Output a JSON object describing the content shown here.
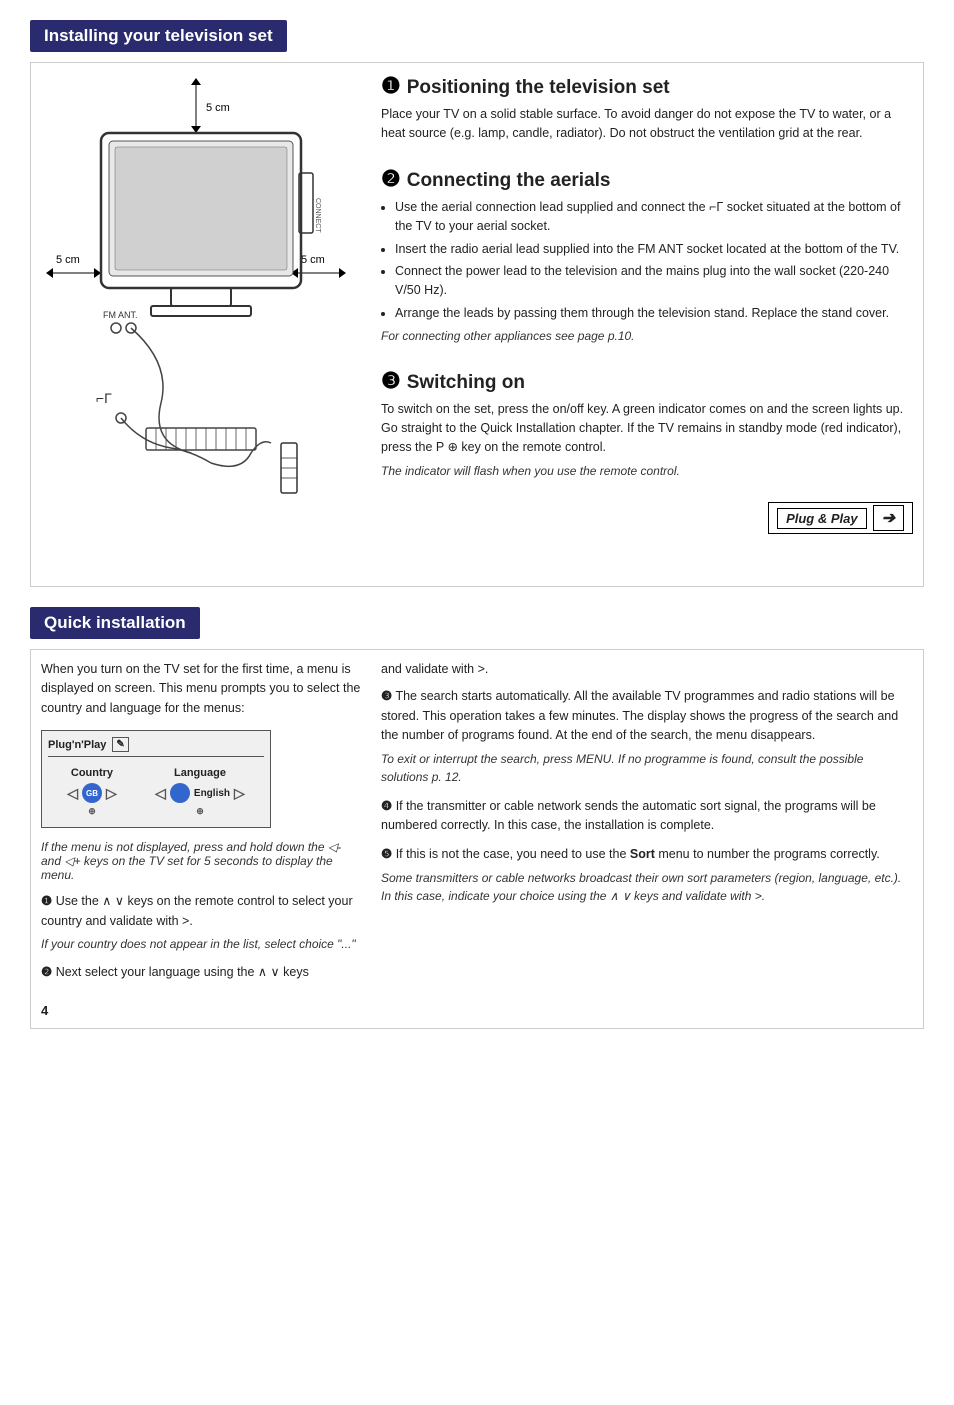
{
  "installing_header": "Installing your television set",
  "quick_header": "Quick installation",
  "steps": {
    "step1": {
      "num": "❶",
      "title": "Positioning the television set",
      "body": "Place your TV on a solid stable surface.  To avoid danger do not expose the TV to water, or a heat source (e.g. lamp, candle, radiator).  Do not obstruct the ventilation grid at the rear."
    },
    "step2": {
      "num": "❷",
      "title": "Connecting the aerials",
      "bullets": [
        "Use the aerial connection lead supplied and connect the ⌐Γ socket situated at the bottom of the TV to your aerial socket.",
        "Insert the radio aerial lead supplied into the FM ANT socket located at the bottom of the TV.",
        "Connect the power lead to the television and the mains plug into the wall socket (220-240 V/50 Hz).",
        "Arrange the leads by passing them through the television stand. Replace the stand cover."
      ],
      "note": "For connecting other appliances see page p.10."
    },
    "step3": {
      "num": "❸",
      "title": "Switching on",
      "body": "To switch on the set, press the on/off key.  A green indicator comes on and the screen lights up.  Go straight to the Quick Installation chapter. If the TV remains in standby mode (red indicator), press the P ⊕ key on the remote control.",
      "note": "The indicator will flash when you use the remote control."
    }
  },
  "plug_play": "Plug & Play",
  "dimensions": {
    "top": "5 cm",
    "left": "5 cm",
    "right": "5 cm"
  },
  "fm_ant": "FM ANT.",
  "quick": {
    "intro": "When you turn on the TV set for the first time, a menu is displayed on screen. This menu prompts you to select the country and language for the menus:",
    "menu_title": "Plug'n'Play",
    "country_label": "Country",
    "language_label": "Language",
    "flag_text": "GB",
    "lang_text": "English",
    "menu_note": "If the menu is not displayed, press and hold down the ◁- and ◁+ keys on the TV set for 5 seconds to display the menu.",
    "q1": {
      "num": "❶",
      "text": "Use the ∧ ∨ keys on the remote control to select your country and validate with >.",
      "note": "If your country does not appear in the list, select choice \"...\""
    },
    "q2": {
      "num": "❷",
      "text": "Next select your language using the ∧ ∨ keys"
    },
    "right_intro": "and validate with >.",
    "q3": {
      "num": "❸",
      "text": "The search starts automatically. All the available TV programmes and radio stations will be stored. This operation takes a few minutes. The display shows the progress of the search and the number of programs found.  At the end of the search, the menu disappears.",
      "note": "To exit or interrupt the search, press MENU. If no programme is found, consult the possible solutions p. 12."
    },
    "q4": {
      "num": "❹",
      "text": "If the transmitter or cable network sends the automatic sort signal, the programs will be numbered correctly. In this case, the installation is complete."
    },
    "q5": {
      "num": "❺",
      "text_before": "If this is not the case, you need to use the ",
      "bold_word": "Sort",
      "text_after": " menu to number the programs correctly.",
      "note": "Some transmitters or cable networks broadcast their own sort parameters (region, language, etc.). In this case, indicate your choice using the ∧ ∨ keys and validate with >."
    }
  },
  "page_number": "4"
}
